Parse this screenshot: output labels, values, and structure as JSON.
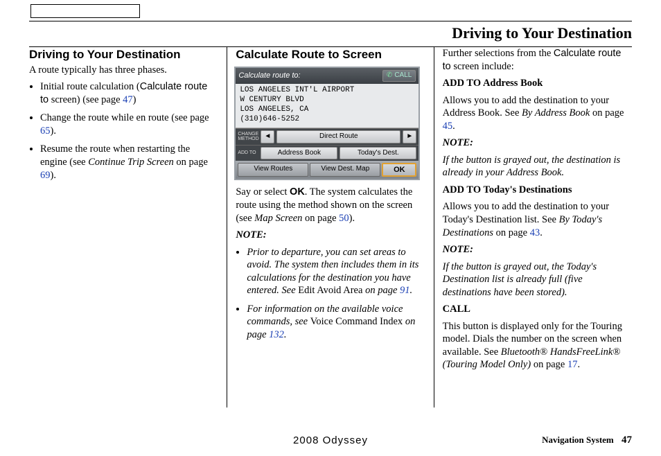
{
  "page_title": "Driving to Your Destination",
  "footer": {
    "model": "2008  Odyssey",
    "section": "Navigation System",
    "page": "47"
  },
  "col1": {
    "heading": "Driving to Your Destination",
    "intro": "A route typically has three phases.",
    "b1_a": "Initial route calculation (",
    "b1_ui": "Calculate route to",
    "b1_b": " screen) (see page ",
    "b1_ref": "47",
    "b1_c": ")",
    "b2_a": "Change the route while en route (see page ",
    "b2_ref": "65",
    "b2_b": ").",
    "b3_a": "Resume the route when restarting the engine (see ",
    "b3_i": "Continue Trip Screen",
    "b3_b": " on page ",
    "b3_ref": "69",
    "b3_c": ")."
  },
  "col2": {
    "heading": "Calculate Route to Screen",
    "p1_a": "Say or select ",
    "p1_b": "OK",
    "p1_c": ". The system calculates the route using the method shown on the screen (see ",
    "p1_i": "Map Screen",
    "p1_d": " on page ",
    "p1_ref": "50",
    "p1_e": ").",
    "note_label": "NOTE:",
    "n1_a": "Prior to departure, you can set areas to avoid. The system then includes them in its calculations for the destination you have entered. See ",
    "n1_r": "Edit Avoid Area",
    "n1_b": " on page ",
    "n1_ref": "91",
    "n1_c": ".",
    "n2_a": "For information on the available voice commands, see ",
    "n2_r": "Voice Command Index",
    "n2_b": " on page ",
    "n2_ref": "132",
    "n2_c": "."
  },
  "nav": {
    "title": "Calculate route to:",
    "call": "CALL",
    "line1": "LOS ANGELES INT'L AIRPORT",
    "line2": "W CENTURY BLVD",
    "line3": "LOS ANGELES, CA",
    "line4": "(310)646-5252",
    "change_lbl": "CHANGE METHOD",
    "direct": "Direct Route",
    "addto_lbl": "ADD TO",
    "addr_book": "Address Book",
    "today": "Today's Dest.",
    "view_routes": "View Routes",
    "view_map": "View Dest. Map",
    "ok": "OK"
  },
  "col3": {
    "p0_a": "Further selections from the ",
    "p0_ui": "Calculate route to",
    "p0_b": " screen include:",
    "h1": "ADD TO Address Book",
    "p1_a": "Allows you to add the destination to your Address Book. See ",
    "p1_i": "By Address Book",
    "p1_b": " on page ",
    "p1_ref": "45",
    "p1_c": ".",
    "note_label": "NOTE:",
    "n1": "If the button is grayed out, the destination is already in your Address Book.",
    "h2": "ADD TO Today's Destinations",
    "p2_a": "Allows you to add the destination to your Today's Destination list. See ",
    "p2_i": "By Today's Destinations",
    "p2_b": " on page ",
    "p2_ref": "43",
    "p2_c": ".",
    "n2": "If the button is grayed out, the Today's Destination list is already full (five destinations have been stored).",
    "h3": "CALL",
    "p3_a": "This button is displayed only for the Touring model. Dials the number on the screen when available. See ",
    "p3_i": "Bluetooth® HandsFreeLink® (Touring Model Only)",
    "p3_b": " on page ",
    "p3_ref": "17",
    "p3_c": "."
  }
}
